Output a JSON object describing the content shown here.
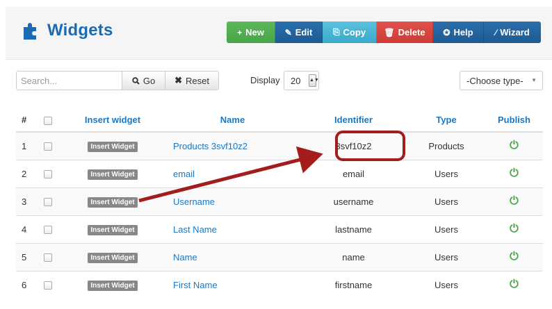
{
  "header": {
    "title": "Widgets",
    "toolbar": [
      {
        "key": "new",
        "label": "New",
        "icon": "plus-icon",
        "glyph": "+"
      },
      {
        "key": "edit",
        "label": "Edit",
        "icon": "edit-icon",
        "glyph": "✎"
      },
      {
        "key": "copy",
        "label": "Copy",
        "icon": "copy-icon",
        "glyph": "⎘"
      },
      {
        "key": "delete",
        "label": "Delete",
        "icon": "trash-icon",
        "glyph": "🗑"
      },
      {
        "key": "help",
        "label": "Help",
        "icon": "lifebuoy-icon",
        "glyph": "✪"
      },
      {
        "key": "wizard",
        "label": "Wizard",
        "icon": "wand-icon",
        "glyph": "⁄"
      }
    ]
  },
  "filters": {
    "search_placeholder": "Search...",
    "go_label": "Go",
    "reset_label": "Reset",
    "display_label": "Display",
    "display_value": "20",
    "type_value": "-Choose type-"
  },
  "table": {
    "columns": {
      "num": "#",
      "insert": "Insert widget",
      "name": "Name",
      "identifier": "Identifier",
      "type": "Type",
      "publish": "Publish"
    },
    "insert_label": "Insert Widget",
    "rows": [
      {
        "num": "1",
        "name": "Products 3svf10z2",
        "identifier": "3svf10z2",
        "type": "Products"
      },
      {
        "num": "2",
        "name": "email",
        "identifier": "email",
        "type": "Users"
      },
      {
        "num": "3",
        "name": "Username",
        "identifier": "username",
        "type": "Users"
      },
      {
        "num": "4",
        "name": "Last Name",
        "identifier": "lastname",
        "type": "Users"
      },
      {
        "num": "5",
        "name": "Name",
        "identifier": "name",
        "type": "Users"
      },
      {
        "num": "6",
        "name": "First Name",
        "identifier": "firstname",
        "type": "Users"
      }
    ]
  },
  "colors": {
    "brand_blue": "#1a6bb3",
    "link_blue": "#1a78c2",
    "publish_green": "#46a546",
    "annotation_red": "#a31d1d"
  }
}
